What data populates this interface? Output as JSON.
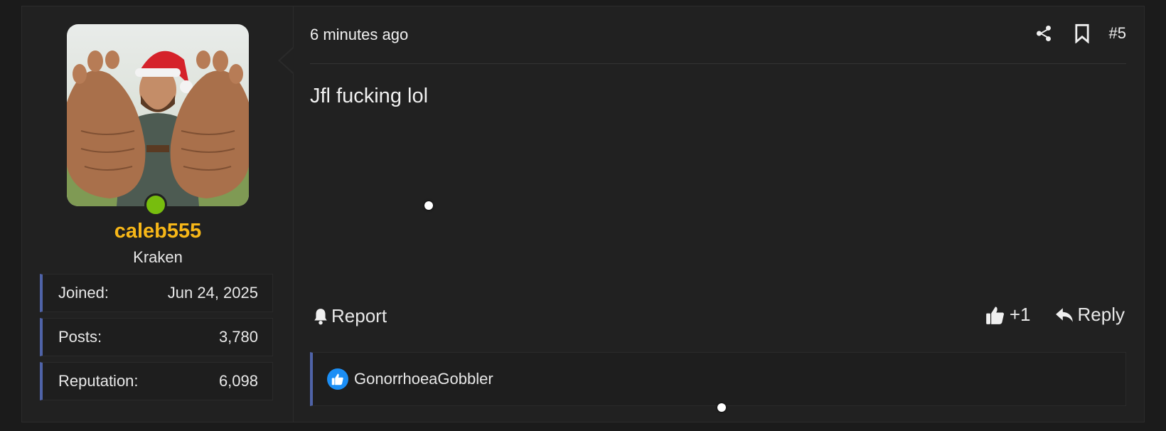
{
  "colors": {
    "username": "#f7b718",
    "online": "#77bd0e",
    "accent_bar": "#4f63a8",
    "like": "#1b8ef5"
  },
  "user": {
    "avatar_description_icon": "avatar-image",
    "name": "caleb555",
    "title": "Kraken",
    "stats": [
      {
        "label": "Joined:",
        "value": "Jun 24, 2025"
      },
      {
        "label": "Posts:",
        "value": "3,780"
      },
      {
        "label": "Reputation:",
        "value": "6,098"
      }
    ]
  },
  "post": {
    "timestamp": "6 minutes ago",
    "number": "#5",
    "message": "Jfl fucking lol",
    "icons": {
      "share": "share-icon",
      "bookmark": "bookmark-icon"
    }
  },
  "footer": {
    "report_label": "Report",
    "like_label": "+1",
    "reply_label": "Reply"
  },
  "reactions": {
    "users": "GonorrhoeaGobbler"
  }
}
